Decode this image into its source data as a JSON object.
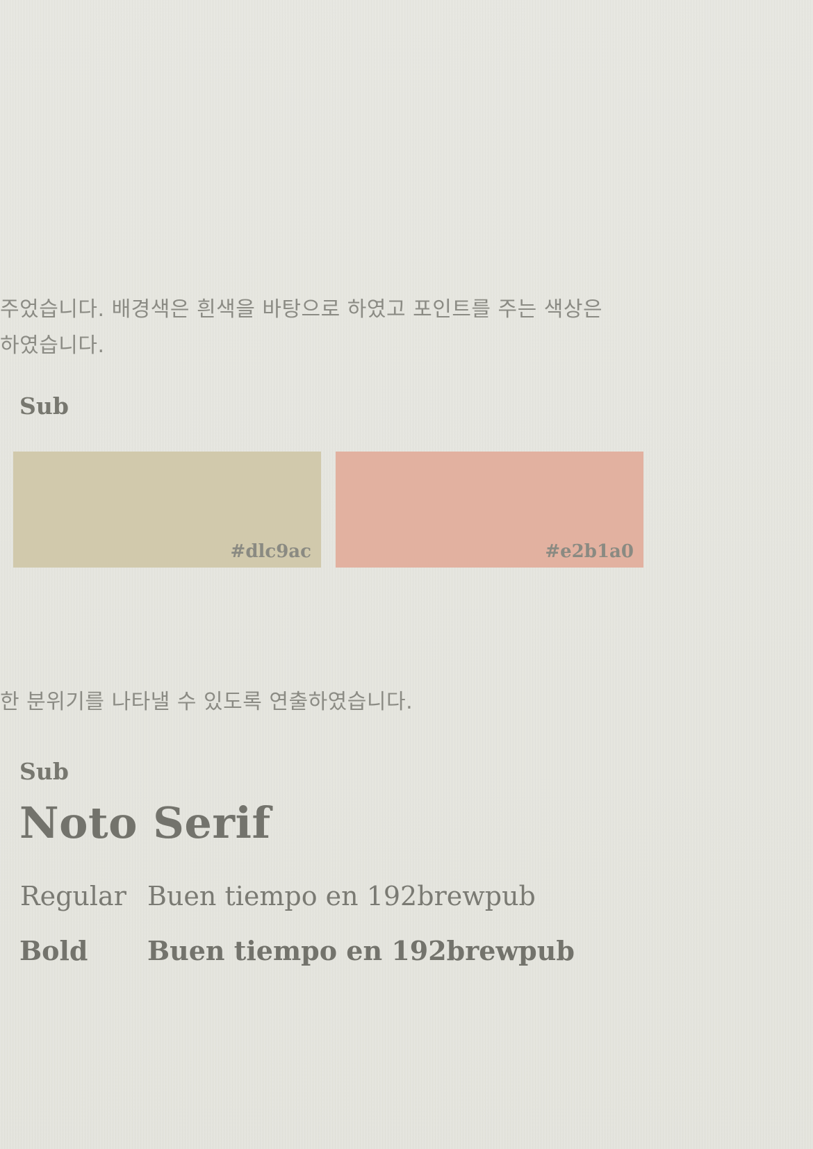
{
  "paragraphs": {
    "colors_line1": "주었습니다. 배경색은 흰색을 바탕으로 하였고 포인트를 주는 색상은",
    "colors_line2": " 하였습니다.",
    "fonts_line1": "한 분위기를 나타낼 수 있도록 연출하였습니다."
  },
  "colors": {
    "sub_label": "Sub",
    "swatches": [
      {
        "hex": "#d1c9ac",
        "code_label": "#dlc9ac"
      },
      {
        "hex": "#e2b1a0",
        "code_label": "#e2b1a0"
      }
    ]
  },
  "typography": {
    "sub_label": "Sub",
    "font_name": "Noto Serif",
    "specimens": [
      {
        "weight_label": "Regular",
        "sample": "Buen tiempo en 192brewpub"
      },
      {
        "weight_label": "Bold",
        "sample": "Buen tiempo en 192brewpub"
      }
    ]
  }
}
